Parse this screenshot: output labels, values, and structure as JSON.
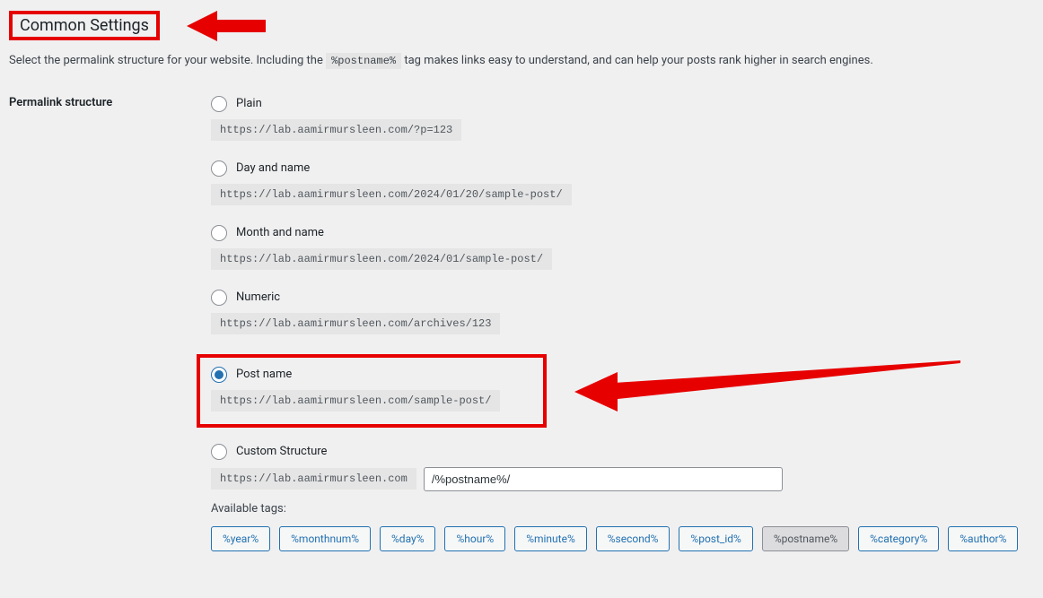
{
  "heading": "Common Settings",
  "description_pre": "Select the permalink structure for your website. Including the ",
  "description_tag": "%postname%",
  "description_post": " tag makes links easy to understand, and can help your posts rank higher in search engines.",
  "structure_label": "Permalink structure",
  "options": {
    "plain": {
      "label": "Plain",
      "example": "https://lab.aamirmursleen.com/?p=123"
    },
    "day": {
      "label": "Day and name",
      "example": "https://lab.aamirmursleen.com/2024/01/20/sample-post/"
    },
    "month": {
      "label": "Month and name",
      "example": "https://lab.aamirmursleen.com/2024/01/sample-post/"
    },
    "numeric": {
      "label": "Numeric",
      "example": "https://lab.aamirmursleen.com/archives/123"
    },
    "postname": {
      "label": "Post name",
      "example": "https://lab.aamirmursleen.com/sample-post/"
    },
    "custom": {
      "label": "Custom Structure",
      "prefix": "https://lab.aamirmursleen.com",
      "value": "/%postname%/"
    }
  },
  "available_tags_label": "Available tags:",
  "tags": [
    "%year%",
    "%monthnum%",
    "%day%",
    "%hour%",
    "%minute%",
    "%second%",
    "%post_id%",
    "%postname%",
    "%category%",
    "%author%"
  ],
  "active_tag": "%postname%"
}
